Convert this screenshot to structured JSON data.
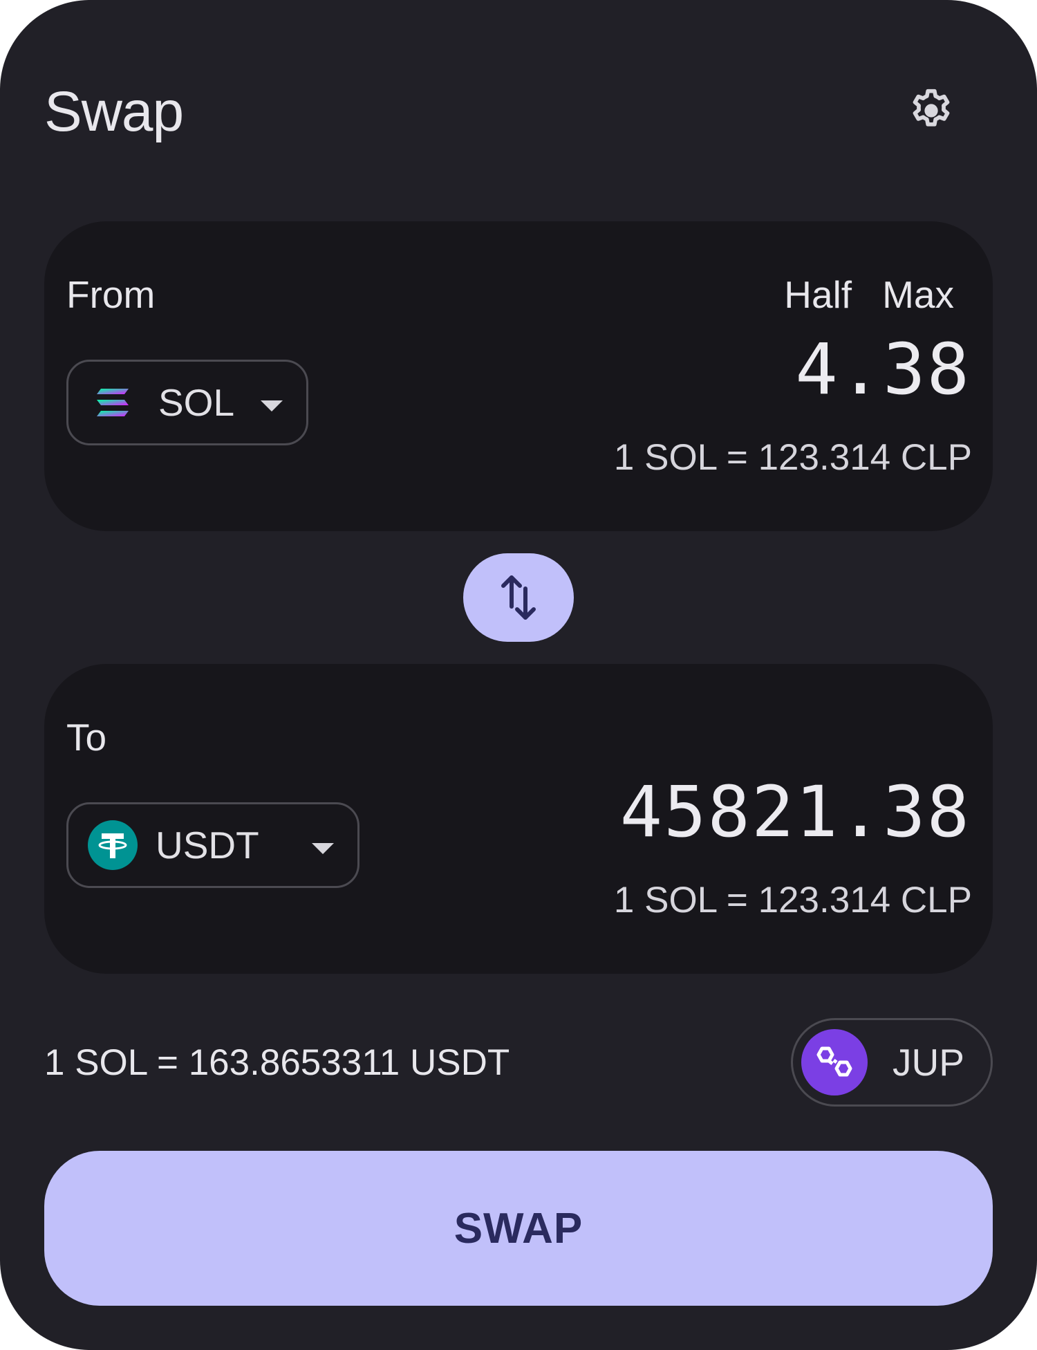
{
  "header": {
    "title": "Swap"
  },
  "from": {
    "label": "From",
    "half_label": "Half",
    "max_label": "Max",
    "token": "SOL",
    "amount": "4.38",
    "rate": "1 SOL = 123.314 CLP"
  },
  "to": {
    "label": "To",
    "token": "USDT",
    "amount": "45821.38",
    "rate": "1 SOL = 123.314 CLP"
  },
  "exchange_rate": "1 SOL = 163.8653311 USDT",
  "route": {
    "name": "JUP"
  },
  "swap_button": {
    "label": "SWAP"
  },
  "colors": {
    "background": "#212027",
    "panel": "#17161b",
    "accent": "#c1c0fa",
    "accent_text": "#2a2a5e",
    "tether_green": "#009393",
    "route_purple": "#7b3fe4"
  },
  "icons": {
    "settings": "gear-icon",
    "sol_token": "solana-logo-icon",
    "usdt_token": "tether-logo-icon",
    "flip": "swap-vertical-arrows-icon",
    "route": "polygon-logo-icon",
    "dropdown": "caret-down-icon"
  }
}
